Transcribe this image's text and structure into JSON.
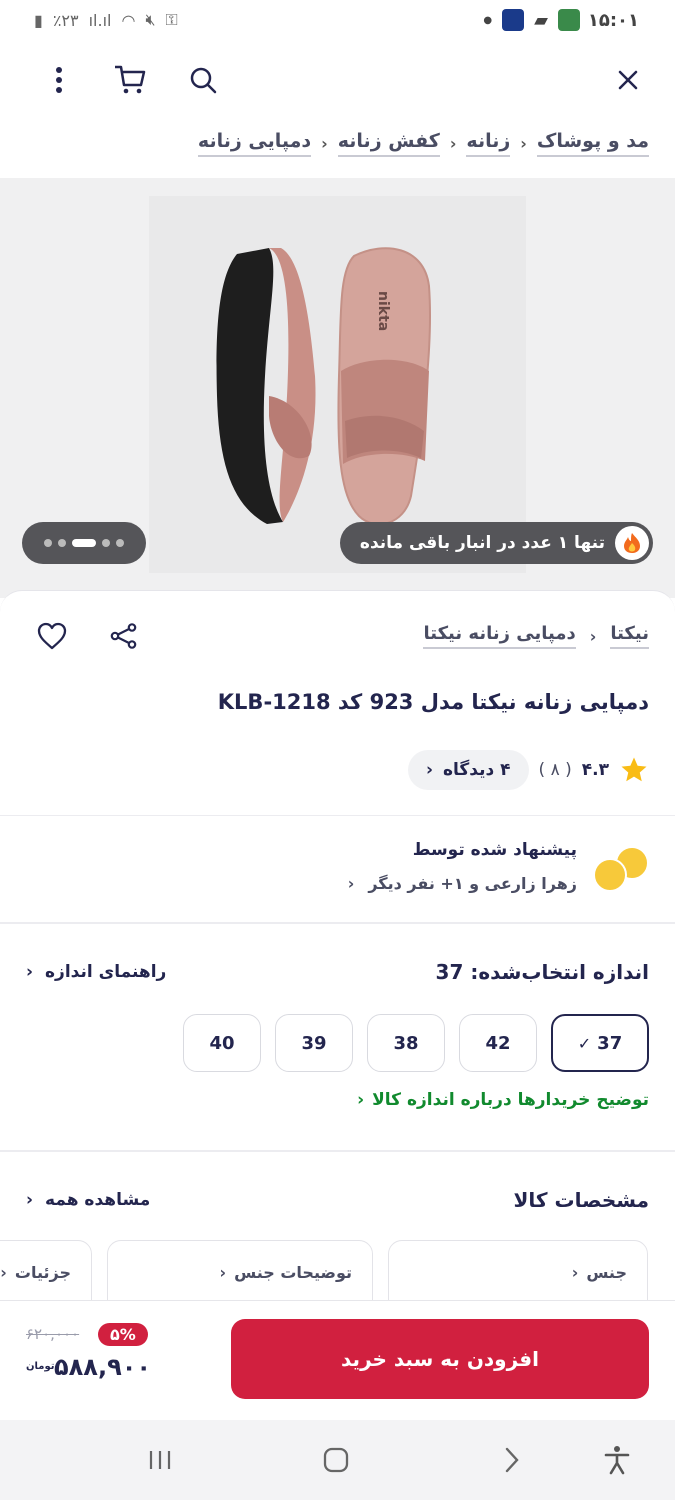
{
  "status_bar": {
    "time": "۱۵:۰۱",
    "battery": "٪۲۳"
  },
  "breadcrumb": [
    "مد و پوشاک",
    "زنانه",
    "کفش زنانه",
    "دمپایی زنانه"
  ],
  "gallery": {
    "stock_badge": "تنها ۱ عدد در انبار باقی مانده",
    "dot_count": 5,
    "active_dot": 2
  },
  "product": {
    "sub_breadcrumb": [
      "نیکتا",
      "دمپایی زنانه نیکتا"
    ],
    "title": "دمپایی زنانه نیکتا مدل 923 کد KLB-1218",
    "rating": "۴.۳",
    "rating_count": "( ۸ )",
    "reviews_label": "۴ دیدگاه"
  },
  "recommended": {
    "title": "پیشنهاد شده توسط",
    "by": "زهرا زارعی و ۱+ نفر دیگر"
  },
  "sizes": {
    "title": "اندازه انتخاب‌شده: 37",
    "guide": "راهنمای اندازه",
    "options": [
      "37",
      "42",
      "38",
      "39",
      "40"
    ],
    "selected": "37",
    "note": "توضیح خریدارها درباره اندازه کالا"
  },
  "specs": {
    "title": "مشخصات کالا",
    "see_all": "مشاهده همه",
    "cards": [
      "جنس",
      "توضیحات جنس",
      "جزئیات"
    ]
  },
  "buy": {
    "button": "افزودن به سبد خرید",
    "discount": "۵%",
    "old_price": "۶۲۰,۰۰۰",
    "price": "۵۸۸,۹۰۰",
    "currency": "تومان"
  },
  "colors": {
    "primary": "#d1203f",
    "text": "#23254e",
    "green": "#118a2e"
  }
}
